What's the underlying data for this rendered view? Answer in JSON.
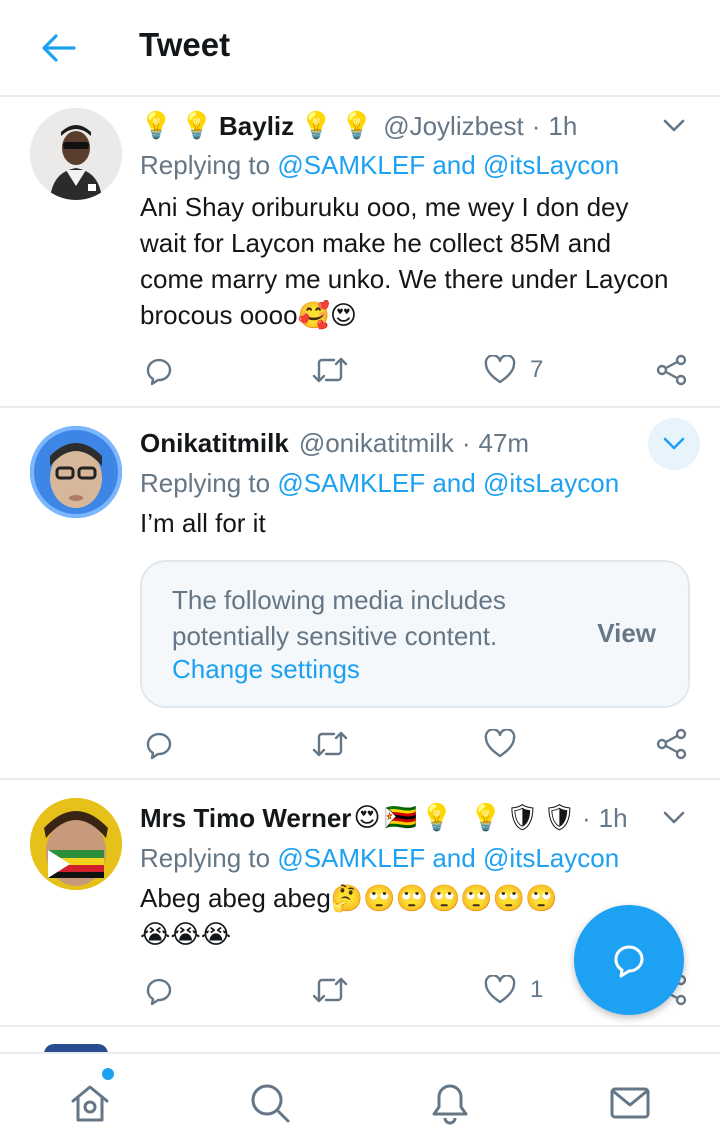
{
  "header": {
    "title": "Tweet"
  },
  "tweets": [
    {
      "name": "Bayliz",
      "name_prefix_emoji": "💡 💡",
      "name_suffix_emoji": "💡 💡",
      "handle": "@Joylizbest",
      "dot": "·",
      "time": "1h",
      "replying_prefix": "Replying to",
      "mention1": "@SAMKLEF",
      "and": "and",
      "mention2": "@itsLaycon",
      "text": "Ani Shay oriburuku ooo, me wey I don dey wait for Laycon make he collect 85M and come marry me unko. We there under Laycon brocous oooo🥰😍",
      "likes": "7"
    },
    {
      "name": "Onikatitmilk",
      "handle": "@onikatitmilk",
      "dot": "·",
      "time": "47m",
      "replying_prefix": "Replying to",
      "mention1": "@SAMKLEF",
      "and": "and",
      "mention2": "@itsLaycon",
      "text": "I’m all for it",
      "sensitive": {
        "message": "The following media includes potentially sensitive content.",
        "view": "View",
        "change": "Change settings"
      }
    },
    {
      "name": "Mrs Timo Werner",
      "name_suffix_emoji": "😍🇿🇼💡 💡🛡🛡",
      "handle": "",
      "dot": "·",
      "time": "1h",
      "replying_prefix": "Replying to",
      "mention1": "@SAMKLEF",
      "and": "and",
      "mention2": "@itsLaycon",
      "text": "Abeg abeg abeg🤔🙄🙄🙄🙄🙄🙄😭😭😭",
      "likes": "1"
    }
  ],
  "icons": {
    "back": "arrow-left-icon",
    "reply": "reply-icon",
    "retweet": "retweet-icon",
    "like": "heart-icon",
    "share": "share-icon",
    "more": "chevron-down-icon",
    "compose": "compose-reply-icon",
    "home": "home-icon",
    "search": "search-icon",
    "notifications": "bell-icon",
    "messages": "mail-icon"
  },
  "colors": {
    "accent": "#1da1f2",
    "muted": "#657786",
    "text": "#14171a",
    "border": "#e6ecf0"
  }
}
